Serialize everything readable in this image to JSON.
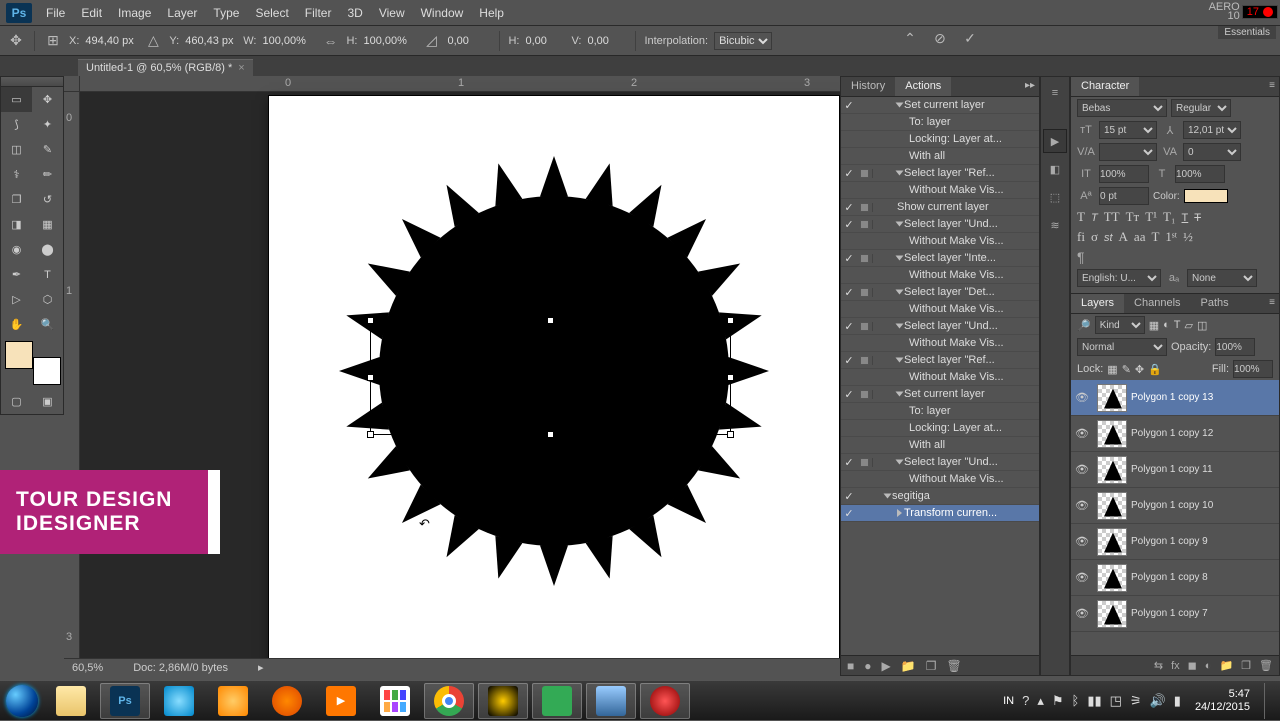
{
  "app": "Ps",
  "menu": [
    "File",
    "Edit",
    "Image",
    "Layer",
    "Type",
    "Select",
    "Filter",
    "3D",
    "View",
    "Window",
    "Help"
  ],
  "recorder": {
    "time": "17",
    "indicator": "AERO",
    "small": "10"
  },
  "workspace": "Essentials",
  "optionsbar": {
    "x": "494,40 px",
    "y": "460,43 px",
    "w": "100,00%",
    "h": "100,00%",
    "angle": "0,00",
    "hskew": "0,00",
    "vskew": "0,00",
    "interp_label": "Interpolation:",
    "interp": "Bicubic"
  },
  "doctab": {
    "title": "Untitled-1 @ 60,5% (RGB/8) *"
  },
  "rulers_h": [
    {
      "v": "0",
      "p": 205
    },
    {
      "v": "1",
      "p": 378
    },
    {
      "v": "2",
      "p": 551
    },
    {
      "v": "3",
      "p": 724
    }
  ],
  "rulers_v": [
    {
      "v": "0",
      "p": 20
    },
    {
      "v": "1",
      "p": 193
    },
    {
      "v": "3",
      "p": 539
    }
  ],
  "statusbar": {
    "zoom": "60,5%",
    "doc": "Doc: 2,86M/0 bytes"
  },
  "panels": {
    "mid_tabs": [
      "History",
      "Actions"
    ],
    "actions": [
      {
        "c": true,
        "d": false,
        "i": 2,
        "t": true,
        "o": true,
        "txt": "Set current layer"
      },
      {
        "c": false,
        "d": false,
        "i": 3,
        "txt": "To: layer"
      },
      {
        "c": false,
        "d": false,
        "i": 3,
        "txt": "Locking: Layer at..."
      },
      {
        "c": false,
        "d": false,
        "i": 3,
        "txt": "With all"
      },
      {
        "c": true,
        "d": true,
        "i": 2,
        "t": true,
        "o": true,
        "txt": "Select layer \"Ref..."
      },
      {
        "c": false,
        "d": false,
        "i": 3,
        "txt": "Without Make Vis..."
      },
      {
        "c": true,
        "d": true,
        "i": 2,
        "txt": "Show current layer"
      },
      {
        "c": true,
        "d": true,
        "i": 2,
        "t": true,
        "o": true,
        "txt": "Select layer \"Und..."
      },
      {
        "c": false,
        "d": false,
        "i": 3,
        "txt": "Without Make Vis..."
      },
      {
        "c": true,
        "d": true,
        "i": 2,
        "t": true,
        "o": true,
        "txt": "Select layer \"Inte..."
      },
      {
        "c": false,
        "d": false,
        "i": 3,
        "txt": "Without Make Vis..."
      },
      {
        "c": true,
        "d": true,
        "i": 2,
        "t": true,
        "o": true,
        "txt": "Select layer \"Det..."
      },
      {
        "c": false,
        "d": false,
        "i": 3,
        "txt": "Without Make Vis..."
      },
      {
        "c": true,
        "d": true,
        "i": 2,
        "t": true,
        "o": true,
        "txt": "Select layer \"Und..."
      },
      {
        "c": false,
        "d": false,
        "i": 3,
        "txt": "Without Make Vis..."
      },
      {
        "c": true,
        "d": true,
        "i": 2,
        "t": true,
        "o": true,
        "txt": "Select layer \"Ref..."
      },
      {
        "c": false,
        "d": false,
        "i": 3,
        "txt": "Without Make Vis..."
      },
      {
        "c": true,
        "d": true,
        "i": 2,
        "t": true,
        "o": true,
        "txt": "Set current layer"
      },
      {
        "c": false,
        "d": false,
        "i": 3,
        "txt": "To: layer"
      },
      {
        "c": false,
        "d": false,
        "i": 3,
        "txt": "Locking: Layer at..."
      },
      {
        "c": false,
        "d": false,
        "i": 3,
        "txt": "With all"
      },
      {
        "c": true,
        "d": true,
        "i": 2,
        "t": true,
        "o": true,
        "txt": "Select layer \"Und..."
      },
      {
        "c": false,
        "d": false,
        "i": 3,
        "txt": "Without Make Vis..."
      },
      {
        "c": true,
        "d": false,
        "i": 1,
        "t": true,
        "o": true,
        "txt": "segitiga"
      },
      {
        "c": true,
        "d": false,
        "i": 2,
        "t": true,
        "txt": "Transform curren...",
        "sel": true
      }
    ]
  },
  "character": {
    "font": "Bebas",
    "style": "Regular",
    "size": "15 pt",
    "leading": "12,01 pt",
    "tracking": "0",
    "vscale": "100%",
    "hscale": "100%",
    "baseline": "0 pt",
    "color_label": "Color:",
    "lang": "English: U...",
    "aa": "None"
  },
  "layerpanel": {
    "tabs": [
      "Layers",
      "Channels",
      "Paths"
    ],
    "kind": "Kind",
    "blend": "Normal",
    "opacity_label": "Opacity:",
    "opacity": "100%",
    "lock_label": "Lock:",
    "fill_label": "Fill:",
    "fill": "100%",
    "layers": [
      {
        "name": "Polygon 1 copy 13",
        "sel": true
      },
      {
        "name": "Polygon 1 copy 12"
      },
      {
        "name": "Polygon 1 copy 11"
      },
      {
        "name": "Polygon 1 copy 10"
      },
      {
        "name": "Polygon 1 copy 9"
      },
      {
        "name": "Polygon 1 copy 8"
      },
      {
        "name": "Polygon 1 copy 7"
      }
    ]
  },
  "watermark": {
    "l1": "TOUR DESIGN",
    "l2": "IDESIGNER"
  },
  "taskbar": {
    "lang": "IN",
    "time": "5:47",
    "date": "24/12/2015"
  }
}
